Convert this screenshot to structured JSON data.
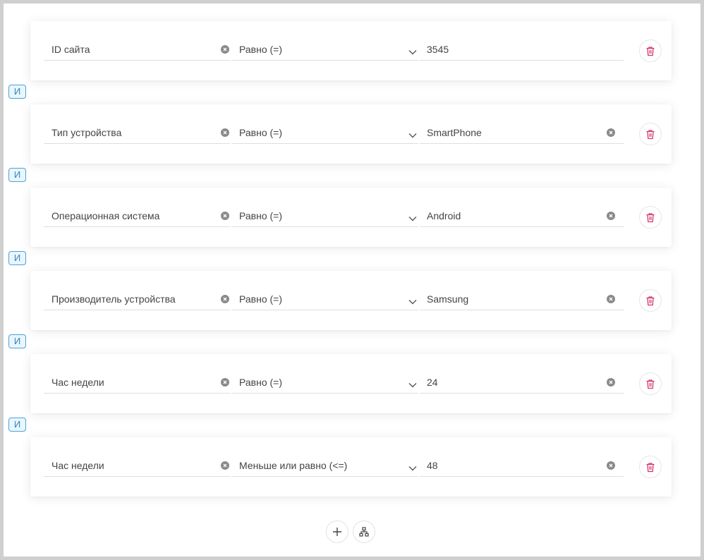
{
  "conditions": [
    {
      "field": "ID сайта",
      "field_clearable": true,
      "operator": "Равно (=)",
      "value": "3545",
      "value_clearable": false
    },
    {
      "field": "Тип устройства",
      "field_clearable": true,
      "operator": "Равно (=)",
      "value": "SmartPhone",
      "value_clearable": true
    },
    {
      "field": "Операционная система",
      "field_clearable": true,
      "operator": "Равно (=)",
      "value": "Android",
      "value_clearable": true
    },
    {
      "field": "Производитель устройства",
      "field_clearable": true,
      "operator": "Равно (=)",
      "value": "Samsung",
      "value_clearable": true
    },
    {
      "field": "Час недели",
      "field_clearable": true,
      "operator": "Равно (=)",
      "value": "24",
      "value_clearable": true
    },
    {
      "field": "Час недели",
      "field_clearable": true,
      "operator": "Меньше или равно (<=)",
      "value": "48",
      "value_clearable": true
    }
  ],
  "connector_label": "И",
  "icons": {
    "clear": "clear-circle-icon",
    "dropdown": "chevron-down-icon",
    "delete": "trash-icon",
    "add": "plus-icon",
    "group": "hierarchy-icon"
  },
  "colors": {
    "delete_icon": "#d6336c",
    "connector_border": "#4aa3d8",
    "connector_text": "#2f86c4",
    "connector_bg": "#eaf5fc",
    "clear_icon": "#8a8a8a"
  }
}
